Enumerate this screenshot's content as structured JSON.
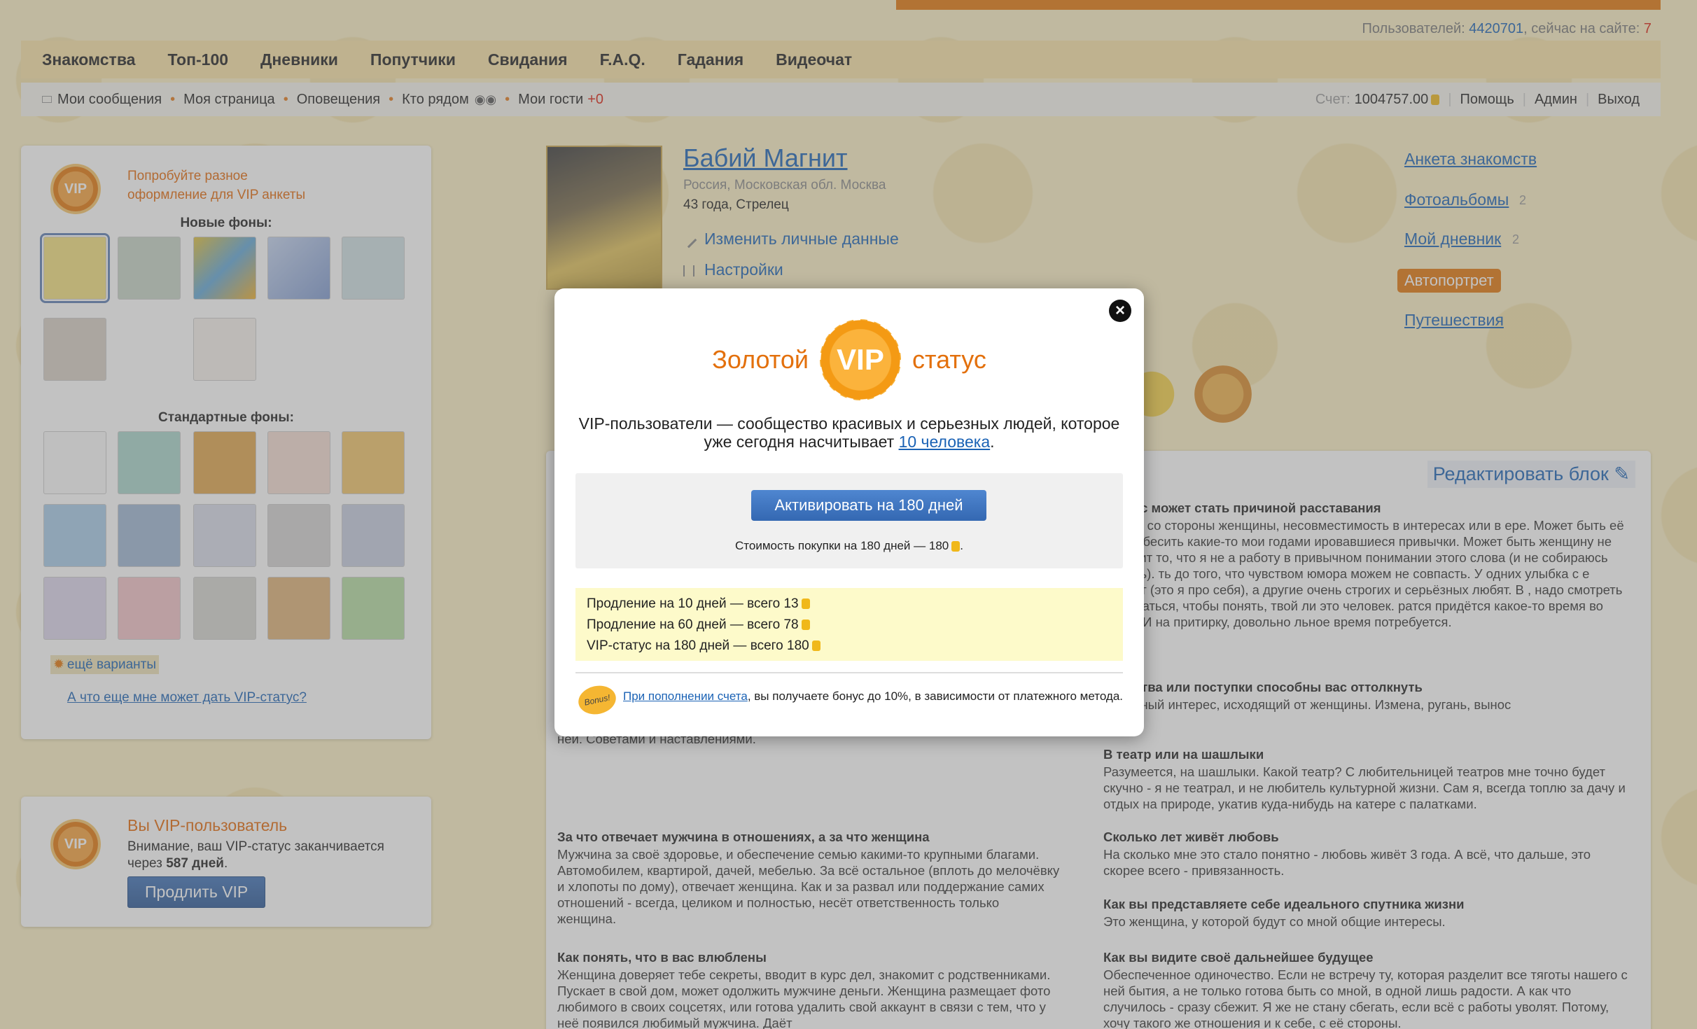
{
  "header": {
    "users_label": "Пользователей:",
    "users_count": "4420701",
    "online_label": ", сейчас на сайте:",
    "online_count": "7"
  },
  "nav_main": [
    "Знакомства",
    "Топ-100",
    "Дневники",
    "Попутчики",
    "Свидания",
    "F.A.Q.",
    "Гадания",
    "Видеочат"
  ],
  "nav_sub": {
    "messages": "Мои сообщения",
    "my_page": "Моя страница",
    "notifications": "Оповещения",
    "nearby": "Кто рядом",
    "guests": "Мои гости",
    "guests_count": "+0",
    "balance_label": "Счет:",
    "balance_value": "1004757.00",
    "help": "Помощь",
    "admin": "Админ",
    "logout": "Выход"
  },
  "left_panel": {
    "badge": "VIP",
    "try_line1": "Попробуйте разное",
    "try_line2": "оформление для VIP анкеты",
    "new_backgrounds": "Новые фоны:",
    "standard_backgrounds": "Стандартные фоны:",
    "more_variants": "ещё варианты",
    "what_vip": "А что еще мне может дать VIP-статус?"
  },
  "vip_user_panel": {
    "badge": "VIP",
    "title": "Вы VIP-пользователь",
    "warning": "Внимание, ваш VIP-статус заканчивается",
    "through": "через",
    "days": "587 дней",
    "extend_button": "Продлить VIP"
  },
  "profile": {
    "name": "Бабий Магнит",
    "location": "Россия, Московская обл. Москва",
    "age": "43 года, Стрелец",
    "edit_link": "Изменить личные данные",
    "settings_link": "Настройки"
  },
  "right_links": {
    "anketa": "Анкета знакомств",
    "albums": "Фотоальбомы",
    "albums_count": "2",
    "diary": "Мой дневник",
    "diary_count": "2",
    "autoportrait": "Автопортрет",
    "travel": "Путешествия"
  },
  "main": {
    "edit_block": "Редактировать блок",
    "left_col": [
      {
        "text": "ней. Советами и наставлениями."
      },
      {
        "q": "За что отвечает мужчина в отношениях, а за что женщина",
        "a": "Мужчина за своё здоровье, и обеспечение семью какими-то крупными благами. Автомобилем, квартирой, дачей, мебелью. За всё остальное (вплоть до мелочёвку и хлопоты по дому), отвечает женщина. Как и за развал или поддержание самих отношений - всегда, целиком и полностью, несёт ответственность только женщина."
      },
      {
        "q": "Как понять, что в вас влюблены",
        "a": "Женщина доверяет тебе секреты, вводит в курс дел, знакомит с родственниками. Пускает в свой дом, может одолжить мужчине деньги. Женщина размещает фото любимого в своих соцсетях, или готова удалить свой аккаунт в связи с тем, что у неё появился любимый мужчина. Даёт"
      }
    ],
    "right_col": [
      {
        "q": "ля вас может стать причиной расставания",
        "a": "жение со стороны женщины, несовместимость в интересах или в ере. Может быть её будут бесить какие-то мои годами ировавшиеся привычки. Может быть женщину не устроит то, что я не а работу в привычном понимании этого слова (и не собираюсь ходить). ть до того, что чувством юмора можем не совпасть. У одних улыбка с е сходит (это я про себя), а другие очень строгих и серьёзных любят. В , надо смотреть и общаться, чтобы понять, твой ли это человек. ратся придётся какое-то время во всём. И на притирку, довольно льное время потребуется."
      },
      {
        "q": "качества или поступки способны вас оттолкнуть",
        "a": "нтильный интерес, исходящий от женщины. Измена, ругань, вынос"
      },
      {
        "q": "В театр или на шашлыки",
        "a": "Разумеется, на шашлыки. Какой театр? С любительницей театров мне точно будет скучно - я не театрал, и не любитель культурной жизни. Сам я, всегда топлю за дачу и отдых на природе, укатив куда-нибудь на катере с палатками."
      },
      {
        "q": "Сколько лет живёт любовь",
        "a": "На сколько мне это стало понятно - любовь живёт 3 года. А всё, что дальше, это скорее всего - привязанность."
      },
      {
        "q": "Как вы представляете себе идеального спутника жизни",
        "a": "Это женщина, у которой будут со мной общие интересы."
      },
      {
        "q": "Как вы видите своё дальнейшее будущее",
        "a": "Обеспеченное одиночество. Если не встречу ту, которая разделит все тяготы нашего с ней бытия, а не только готова быть со мной, в одной лишь радости. А как что случилось - сразу сбежит. Я же не стану сбегать, если всё с работы уволят. Потому, хочу такого же отношения и к себе, с её стороны."
      }
    ]
  },
  "modal": {
    "title_left": "Золотой",
    "title_badge": "VIP",
    "title_right": "статус",
    "desc_main": "VIP-пользователи — сообщество красивых и серьезных людей, которое уже сегодня насчитывает",
    "desc_link": "10 человека",
    "desc_end": ".",
    "activate_button": "Активировать на 180 дней",
    "cost_text": "Стоимость покупки на 180 дней — 180",
    "offers": [
      "Продление на 10 дней — всего 13",
      "Продление на 60 дней — всего 78",
      "VIP-статус на 180 дней — всего 180"
    ],
    "bonus_badge": "Bonus!",
    "bonus_link": "При пополнении счета",
    "bonus_text": ", вы получаете бонус до 10%, в зависимости от платежного метода.",
    "close": "×"
  },
  "colors": {
    "accent_orange": "#e3780c",
    "link_blue": "#1a62b5",
    "button_blue": "#3468b2",
    "nav_yellow": "#fae3a8"
  }
}
